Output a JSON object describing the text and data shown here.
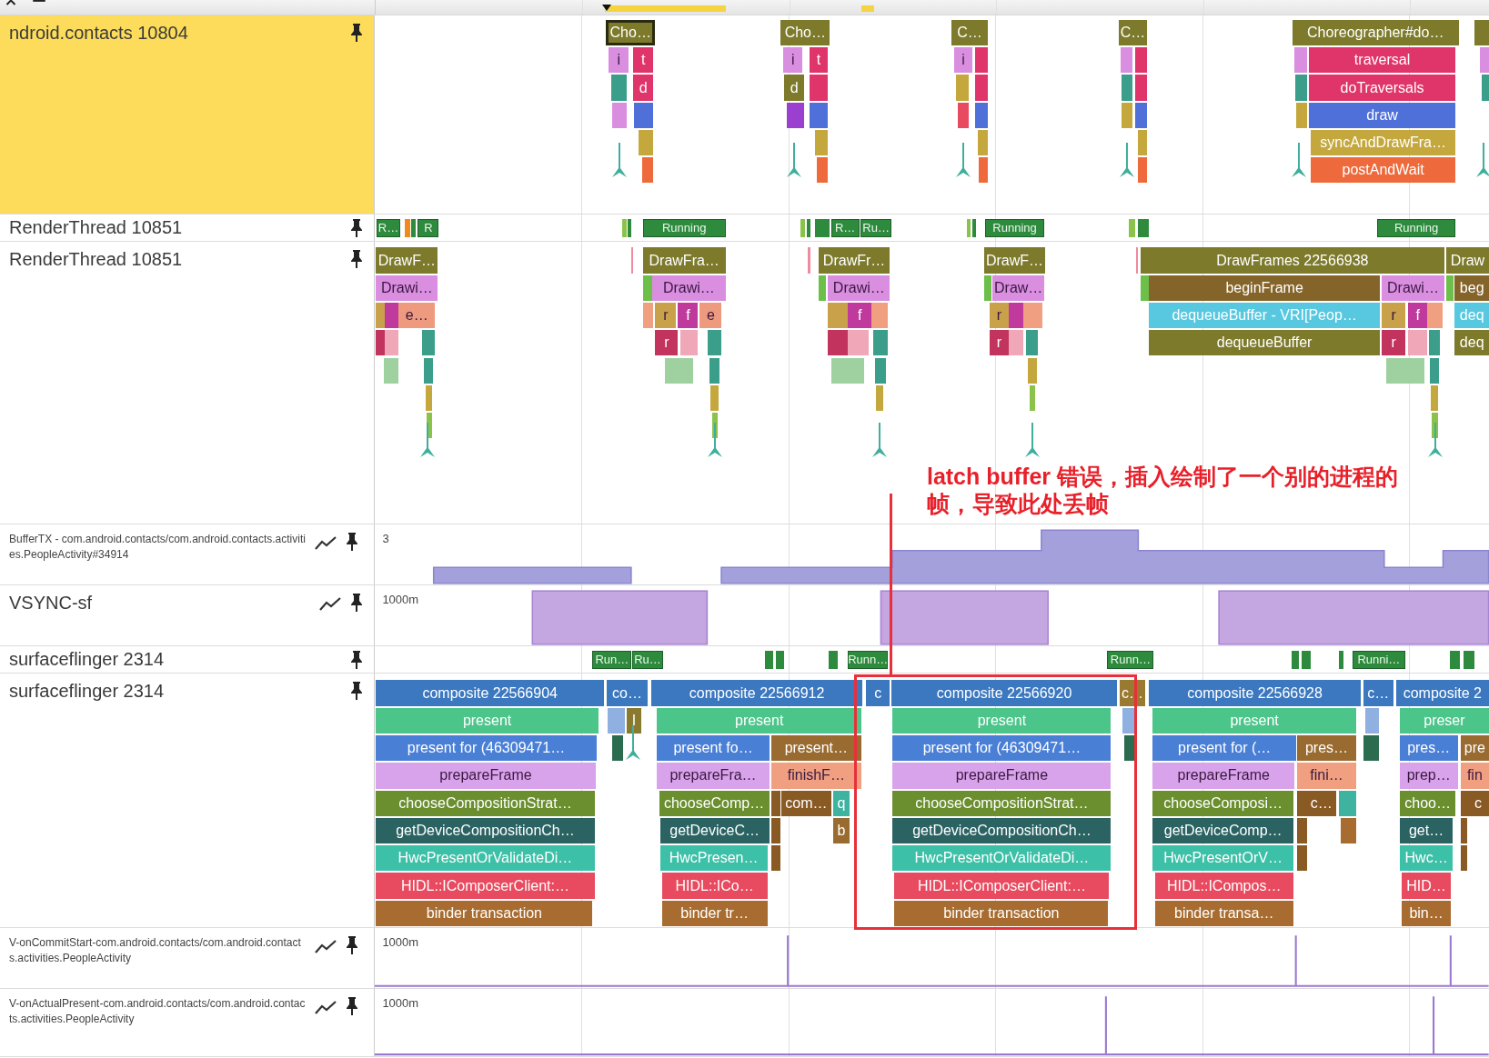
{
  "tracks": [
    {
      "kind": "thread",
      "label": "ndroid.contacts 10804",
      "selected": true,
      "slices": [
        {
          "text": "Cho…",
          "color": "#7d7a2c",
          "selected": true
        },
        {
          "text": "i",
          "color": "#d98ee0",
          "selected": false
        },
        {
          "text": "t",
          "color": "#e0356a",
          "selected": false
        },
        {
          "text": "d",
          "color": "#e0356a",
          "selected": false
        },
        {
          "text": "Cho…",
          "color": "#7d7a2c",
          "selected": false
        },
        {
          "text": "i",
          "color": "#d98ee0",
          "selected": false
        },
        {
          "text": "t",
          "color": "#e0356a",
          "selected": false
        },
        {
          "text": "d",
          "color": "#7d7a2c",
          "selected": false
        },
        {
          "text": "C…",
          "color": "#7d7a2c",
          "selected": false
        },
        {
          "text": "i",
          "color": "#d98ee0",
          "selected": false
        },
        {
          "text": "C…",
          "color": "#7d7a2c",
          "selected": false
        },
        {
          "text": "Choreographer#do…",
          "color": "#7d7a2c",
          "selected": false
        },
        {
          "text": "traversal",
          "color": "#e0356a",
          "selected": false
        },
        {
          "text": "doTraversals",
          "color": "#e0356a",
          "selected": false
        },
        {
          "text": "draw",
          "color": "#4f6fd9",
          "selected": false
        },
        {
          "text": "syncAndDrawFra…",
          "color": "#c4a83e",
          "selected": false
        },
        {
          "text": "postAndWait",
          "color": "#ee6a3c",
          "selected": false
        }
      ]
    },
    {
      "kind": "state",
      "label": "RenderThread 10851",
      "selected": false,
      "slices": [
        {
          "text": "R…"
        },
        {
          "text": "R"
        },
        {
          "text": "Running"
        },
        {
          "text": "R…"
        },
        {
          "text": "Ru…"
        },
        {
          "text": "Running"
        },
        {
          "text": "Running"
        }
      ]
    },
    {
      "kind": "thread",
      "label": "RenderThread 10851",
      "selected": false,
      "slices": [
        {
          "text": "DrawF…",
          "color": "#7d7a2c"
        },
        {
          "text": "Drawi…",
          "color": "#d98ee0"
        },
        {
          "text": "e…",
          "color": "#ee9a7e"
        },
        {
          "text": "DrawFra…",
          "color": "#7d7a2c"
        },
        {
          "text": "Drawi…",
          "color": "#d98ee0"
        },
        {
          "text": "r",
          "color": "#c9a14a"
        },
        {
          "text": "f",
          "color": "#c0399c"
        },
        {
          "text": "e",
          "color": "#ee9a7e"
        },
        {
          "text": "r",
          "color": "#c2335e"
        },
        {
          "text": "DrawFr…",
          "color": "#7d7a2c"
        },
        {
          "text": "Drawi…",
          "color": "#d98ee0"
        },
        {
          "text": "f",
          "color": "#c0399c"
        },
        {
          "text": "DrawF…",
          "color": "#7d7a2c"
        },
        {
          "text": "Draw…",
          "color": "#d98ee0"
        },
        {
          "text": "r",
          "color": "#c9a14a"
        },
        {
          "text": "r",
          "color": "#c2335e"
        },
        {
          "text": "DrawFrames 22566938",
          "color": "#7d7a2c"
        },
        {
          "text": "beginFrame",
          "color": "#85642a"
        },
        {
          "text": "Drawi…",
          "color": "#d98ee0"
        },
        {
          "text": "dequeueBuffer - VRI[Peop…",
          "color": "#57c8e0"
        },
        {
          "text": "r",
          "color": "#c9a14a"
        },
        {
          "text": "f",
          "color": "#c0399c"
        },
        {
          "text": "dequeueBuffer",
          "color": "#7d7a2c"
        },
        {
          "text": "r",
          "color": "#c2335e"
        },
        {
          "text": "Draw",
          "color": "#7d7a2c"
        },
        {
          "text": "beg",
          "color": "#85642a"
        },
        {
          "text": "deq",
          "color": "#57c8e0"
        },
        {
          "text": "deq",
          "color": "#7d7a2c"
        }
      ]
    },
    {
      "kind": "counter",
      "label": "BufferTX - com.android.contacts/com.android.contacts.activities.PeopleActivity#34914",
      "selected": false,
      "scale_label": "3"
    },
    {
      "kind": "counter",
      "label": "VSYNC-sf",
      "selected": false,
      "scale_label": "1000m"
    },
    {
      "kind": "state",
      "label": "surfaceflinger 2314",
      "selected": false,
      "slices": [
        {
          "text": "Run…"
        },
        {
          "text": "Ru…"
        },
        {
          "text": "Runn…"
        },
        {
          "text": "Runn…"
        },
        {
          "text": "Runni…"
        }
      ]
    },
    {
      "kind": "thread",
      "label": "surfaceflinger 2314",
      "selected": false,
      "slices": [
        {
          "text": "composite 22566904",
          "color": "#3b78c0"
        },
        {
          "text": "co…",
          "color": "#3b78c0"
        },
        {
          "text": "composite 22566912",
          "color": "#3b78c0"
        },
        {
          "text": "c",
          "color": "#3b78c0"
        },
        {
          "text": "composite 22566920",
          "color": "#3b78c0"
        },
        {
          "text": "c…",
          "color": "#9a7a30"
        },
        {
          "text": "composite 22566928",
          "color": "#3b78c0"
        },
        {
          "text": "c…",
          "color": "#3b78c0"
        },
        {
          "text": "composite 2",
          "color": "#3b78c0"
        },
        {
          "text": "present",
          "color": "#4cc58a"
        },
        {
          "text": "I",
          "color": "#8a7a30"
        },
        {
          "text": "present",
          "color": "#4cc58a"
        },
        {
          "text": "present",
          "color": "#4cc58a"
        },
        {
          "text": "present",
          "color": "#4cc58a"
        },
        {
          "text": "preser",
          "color": "#4cc58a"
        },
        {
          "text": "present for  (46309471…",
          "color": "#4a7fd6"
        },
        {
          "text": "present fo…",
          "color": "#4a7fd6"
        },
        {
          "text": "present…",
          "color": "#9a6b30"
        },
        {
          "text": "present for  (46309471…",
          "color": "#4a7fd6"
        },
        {
          "text": "present for  (…",
          "color": "#4a7fd6"
        },
        {
          "text": "pres…",
          "color": "#9a6b30"
        },
        {
          "text": "pres…",
          "color": "#4a7fd6"
        },
        {
          "text": "pre",
          "color": "#9a6b30"
        },
        {
          "text": "prepareFrame",
          "color": "#d8a3ea"
        },
        {
          "text": "prepareFra…",
          "color": "#d8a3ea"
        },
        {
          "text": "finishF…",
          "color": "#f0a080"
        },
        {
          "text": "prepareFrame",
          "color": "#d8a3ea"
        },
        {
          "text": "prepareFrame",
          "color": "#d8a3ea"
        },
        {
          "text": "fini…",
          "color": "#f0a080"
        },
        {
          "text": "prep…",
          "color": "#d8a3ea"
        },
        {
          "text": "fin",
          "color": "#f0a080"
        },
        {
          "text": "chooseCompositionStrat…",
          "color": "#6b8e2e"
        },
        {
          "text": "chooseComp…",
          "color": "#6b8e2e"
        },
        {
          "text": "com…",
          "color": "#8a5a24"
        },
        {
          "text": "q",
          "color": "#3db3a0"
        },
        {
          "text": "chooseCompositionStrat…",
          "color": "#6b8e2e"
        },
        {
          "text": "chooseComposi…",
          "color": "#6b8e2e"
        },
        {
          "text": "c…",
          "color": "#8a5a24"
        },
        {
          "text": "choo…",
          "color": "#6b8e2e"
        },
        {
          "text": "c",
          "color": "#8a5a24"
        },
        {
          "text": "getDeviceCompositionCh…",
          "color": "#2b6363"
        },
        {
          "text": "getDeviceC…",
          "color": "#2b6363"
        },
        {
          "text": "b",
          "color": "#9a6b30"
        },
        {
          "text": "getDeviceCompositionCh…",
          "color": "#2b6363"
        },
        {
          "text": "getDeviceComp…",
          "color": "#2b6363"
        },
        {
          "text": "get…",
          "color": "#2b6363"
        },
        {
          "text": "HwcPresentOrValidateDi…",
          "color": "#3dc0a8"
        },
        {
          "text": "HwcPresen…",
          "color": "#3dc0a8"
        },
        {
          "text": "HwcPresentOrValidateDi…",
          "color": "#3dc0a8"
        },
        {
          "text": "HwcPresentOrV…",
          "color": "#3dc0a8"
        },
        {
          "text": "Hwc…",
          "color": "#3dc0a8"
        },
        {
          "text": "HIDL::IComposerClient:…",
          "color": "#e84a5f"
        },
        {
          "text": "HIDL::ICo…",
          "color": "#e84a5f"
        },
        {
          "text": "HIDL::IComposerClient:…",
          "color": "#e84a5f"
        },
        {
          "text": "HIDL::ICompos…",
          "color": "#e84a5f"
        },
        {
          "text": "HID…",
          "color": "#e84a5f"
        },
        {
          "text": "binder transaction",
          "color": "#a86c30"
        },
        {
          "text": "binder tr…",
          "color": "#a86c30"
        },
        {
          "text": "binder transaction",
          "color": "#a86c30"
        },
        {
          "text": "binder transa…",
          "color": "#a86c30"
        },
        {
          "text": "bin…",
          "color": "#a86c30"
        }
      ]
    },
    {
      "kind": "counter",
      "label": "V-onCommitStart-com.android.contacts/com.android.contacts.activities.PeopleActivity",
      "selected": false,
      "scale_label": "1000m"
    },
    {
      "kind": "counter",
      "label": "V-onActualPresent-com.android.contacts/com.android.contacts.activities.PeopleActivity",
      "selected": false,
      "scale_label": "1000m"
    }
  ],
  "annotation": {
    "text": "latch buffer 错误，插入绘制了一个别的进程的帧，导致此处丢帧"
  }
}
